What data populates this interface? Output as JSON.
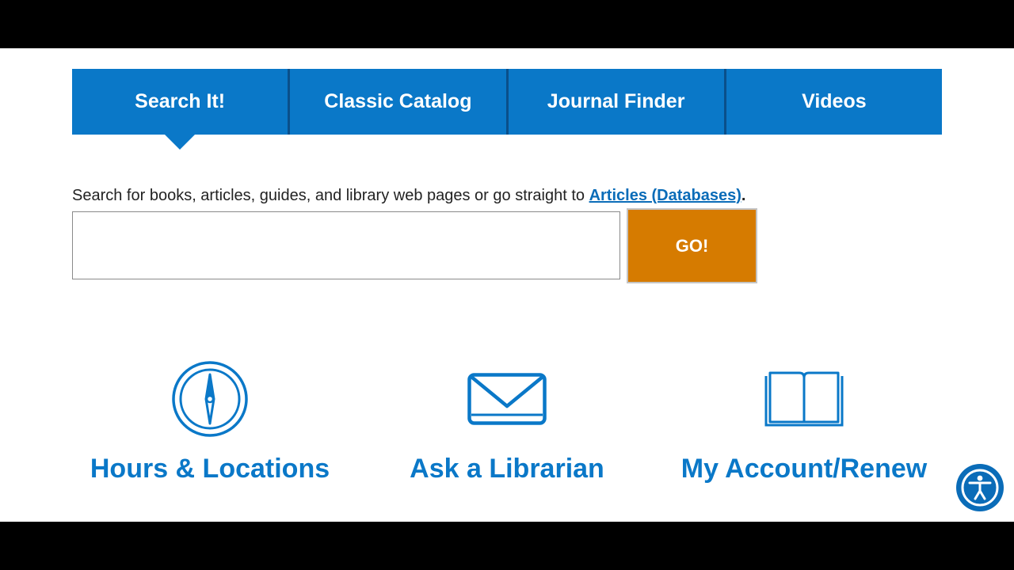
{
  "tabs": [
    {
      "label": "Search It!",
      "active": true
    },
    {
      "label": "Classic Catalog",
      "active": false
    },
    {
      "label": "Journal Finder",
      "active": false
    },
    {
      "label": "Videos",
      "active": false
    }
  ],
  "intro": {
    "text": "Search for books, articles, guides, and library web pages or go straight to ",
    "link_label": "Articles (Databases)",
    "suffix": "."
  },
  "search": {
    "value": "",
    "button_label": "GO!"
  },
  "quick_links": [
    {
      "label": "Hours & Locations",
      "icon": "compass-icon"
    },
    {
      "label": "Ask a Librarian",
      "icon": "envelope-icon"
    },
    {
      "label": "My Account/Renew",
      "icon": "open-book-icon"
    }
  ],
  "accessibility": {
    "icon": "accessibility-icon"
  },
  "colors": {
    "tab_blue": "#0a78c8",
    "tab_divider": "#0a4f8a",
    "link_blue": "#0a6cb8",
    "go_orange": "#d67b00"
  }
}
